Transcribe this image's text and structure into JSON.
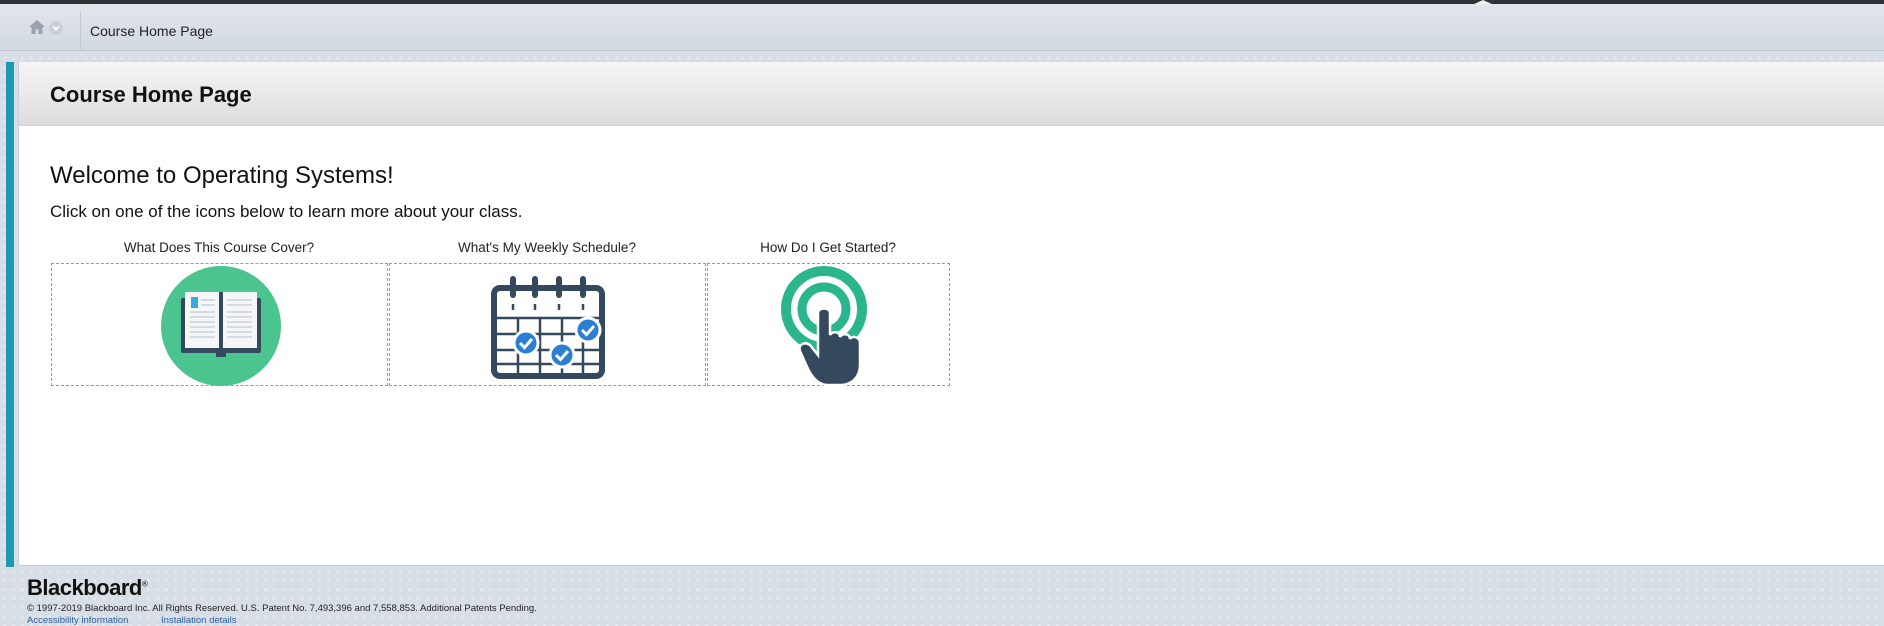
{
  "breadcrumb": {
    "home_icon": "home-icon",
    "menu_icon": "chevron-down-icon",
    "current": "Course Home Page"
  },
  "page": {
    "title": "Course Home Page",
    "welcome": "Welcome to Operating Systems!",
    "instructions": "Click on one of the icons below to learn more about your class."
  },
  "tiles": [
    {
      "label": "What Does This Course Cover?",
      "icon": "open-book-icon"
    },
    {
      "label": "What's My Weekly Schedule?",
      "icon": "calendar-check-icon"
    },
    {
      "label": "How Do I Get Started?",
      "icon": "touch-hand-icon"
    }
  ],
  "colors": {
    "accent_bar": "#1e9ab0",
    "icon_green": "#4cc48f",
    "icon_teal": "#2bb58c",
    "icon_navy": "#34495e",
    "check_blue": "#2a7fd4"
  },
  "footer": {
    "logo": "Blackboard",
    "copyright": "© 1997-2019 Blackboard Inc. All Rights Reserved. U.S. Patent No. 7,493,396 and 7,558,853. Additional Patents Pending.",
    "links": [
      "Accessibility information",
      "Installation details"
    ]
  }
}
